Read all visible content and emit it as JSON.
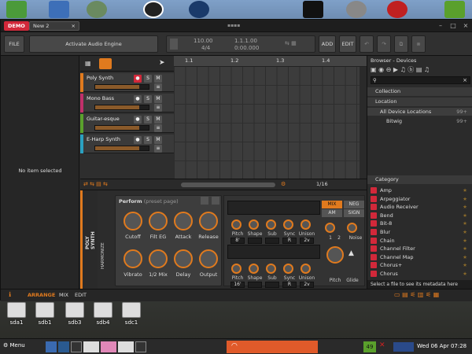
{
  "app": {
    "demo_label": "DEMO",
    "tab_label": "New 2",
    "tab_close": "×"
  },
  "toolbar": {
    "file": "FILE",
    "activate": "Activate Audio Engine",
    "tempo": "110.00",
    "sig": "4/4",
    "position": "1.1.1.00",
    "time": "0:00.000",
    "add": "ADD",
    "edit": "EDIT"
  },
  "inspector": {
    "empty_text": "No item selected"
  },
  "tracks": [
    {
      "name": "Poly Synth",
      "color": "#e07a1e",
      "fader": 0.82
    },
    {
      "name": "Mono Bass",
      "color": "#c0306a",
      "fader": 0.82
    },
    {
      "name": "Guitar-esque",
      "color": "#5aa02c",
      "fader": 0.82
    },
    {
      "name": "E-Harp Synth",
      "color": "#2aa0c0",
      "fader": 0.82
    }
  ],
  "track_buttons": {
    "solo": "S",
    "mute": "M"
  },
  "ruler": [
    "1.1",
    "1.2",
    "1.3",
    "1.4"
  ],
  "arrange_bar": {
    "zoom": "1/16"
  },
  "device": {
    "strip_label": "POLY SYNTH",
    "perform_title": "Perform",
    "perform_sub": "(preset page)",
    "side_label": "HARMONIZE",
    "knobs": [
      "Cutoff",
      "Filt EG",
      "Attack",
      "Release",
      "Vibrato",
      "1/2 Mix",
      "Delay",
      "Output"
    ],
    "synth_labels": [
      "Pitch",
      "Shape",
      "Sub",
      "Sync",
      "Unison"
    ],
    "synth_values1": [
      "8'",
      "",
      "",
      "R",
      "2v"
    ],
    "synth_values2": [
      "16'",
      "",
      "",
      "R",
      "2v"
    ],
    "mix_tabs": [
      "MIX",
      "NEG",
      "AM",
      "SIGN"
    ],
    "noise": "Noise",
    "glide": "Glide",
    "pitch": "Pitch",
    "one": "1",
    "two": "2"
  },
  "browser": {
    "title": "Browser - Devices",
    "collection": "Collection",
    "location": "Location",
    "all_loc": "All Device Locations",
    "bitwig": "Bitwig",
    "category": "Category",
    "footer": "Select a file to see its metadata here",
    "count": "99+",
    "items": [
      "Amp",
      "Arpeggiator",
      "Audio Receiver",
      "Bend",
      "Bit-8",
      "Blur",
      "Chain",
      "Channel Filter",
      "Channel Map",
      "Chorus+",
      "Chorus"
    ]
  },
  "appbar": {
    "arrange": "ARRANGE",
    "mix": "MIX",
    "edit": "EDIT"
  },
  "drives": [
    "sda1",
    "sdb1",
    "sdb3",
    "sdb4",
    "sdc1"
  ],
  "taskbar": {
    "menu": "Menu",
    "clock": "Wed 06 Apr 07:28",
    "badge": "49"
  }
}
